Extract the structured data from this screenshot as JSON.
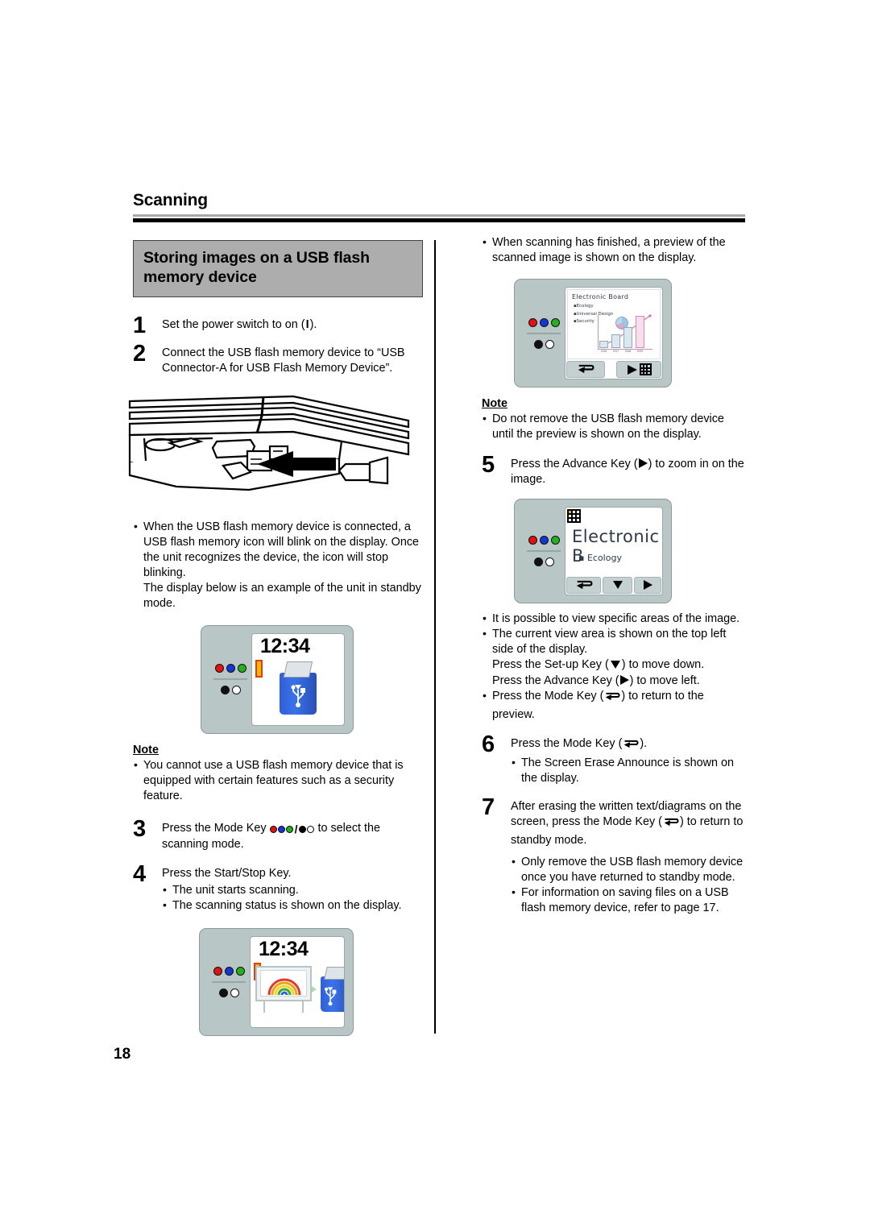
{
  "header": {
    "title": "Scanning"
  },
  "page_number": "18",
  "left_column": {
    "section_title": "Storing images on a USB flash memory device",
    "step1": {
      "number": "1",
      "text_before": "Set the power switch to on (",
      "power_symbol": "I",
      "text_after": ")."
    },
    "step2": {
      "number": "2",
      "text": "Connect the USB flash memory device to “USB Connector-A for USB Flash Memory Device”."
    },
    "bullet_usb_connected": {
      "line1": "When the USB flash memory device is connected, a USB flash memory icon will blink on the display. Once the unit recognizes the device, the icon will stop blinking.",
      "line2": "The display below is an example of the unit in standby mode."
    },
    "standby_display": {
      "clock": "12:34",
      "icon": "usb-flash-drive-icon"
    },
    "note_label": "Note",
    "note_bullet": "You cannot use a USB flash memory device that is equipped with certain features such as a security feature.",
    "step3": {
      "number": "3",
      "text_before": "Press the Mode Key ",
      "text_after": " to select the scanning mode."
    },
    "step4": {
      "number": "4",
      "text": "Press the Start/Stop Key.",
      "bullets": [
        "The unit starts scanning.",
        "The scanning status is shown on the display."
      ]
    },
    "scanning_display": {
      "clock": "12:34",
      "icons": "whiteboard-to-usb-transfer"
    }
  },
  "right_column": {
    "bullet_preview": "When scanning has finished, a preview of the scanned image is shown on the display.",
    "preview_display": {
      "doc_title": "Electronic Board",
      "doc_bullets": [
        "Ecology",
        "Universal Design",
        "Security"
      ],
      "chart_labels": [
        "2016",
        "2017",
        "2018",
        "2019"
      ]
    },
    "note_label": "Note",
    "note_bullet": "Do not remove the USB flash memory device until the preview is shown on the display.",
    "step5": {
      "number": "5",
      "text_before": "Press the Advance Key (",
      "text_after": ") to zoom in on the image."
    },
    "zoom_display": {
      "text": "Electronic B",
      "bullet": "Ecology"
    },
    "bullets_after_step5": {
      "b1": "It is possible to view specific areas of the image.",
      "b2_line1": "The current view area is shown on the top left side of the display.",
      "b2_line2_before": "Press the Set-up Key (",
      "b2_line2_after": ") to move down.",
      "b2_line3_before": "Press the Advance Key (",
      "b2_line3_after": ") to move left.",
      "b3_before": "Press the Mode Key (",
      "b3_after": ") to return to the preview."
    },
    "step6": {
      "number": "6",
      "text_before": "Press the Mode Key (",
      "text_after": ").",
      "bullet": "The Screen Erase Announce is shown on the display."
    },
    "step7": {
      "number": "7",
      "text_before": "After erasing the written text/diagrams on the screen, press the Mode Key (",
      "text_after": ") to return to standby mode.",
      "bullets": [
        "Only remove the USB flash memory device once you have returned to standby mode.",
        "For information on saving files on a USB flash memory device, refer to page 17."
      ]
    }
  },
  "colors": {
    "title_box_bg": "#adadad",
    "led_red": "#e21212",
    "led_blue": "#1436d6",
    "led_green": "#23b11e",
    "highlight_orange": "#f0a800",
    "usb_blue": "#3a72ea",
    "device_body": "#b9c6c6"
  }
}
